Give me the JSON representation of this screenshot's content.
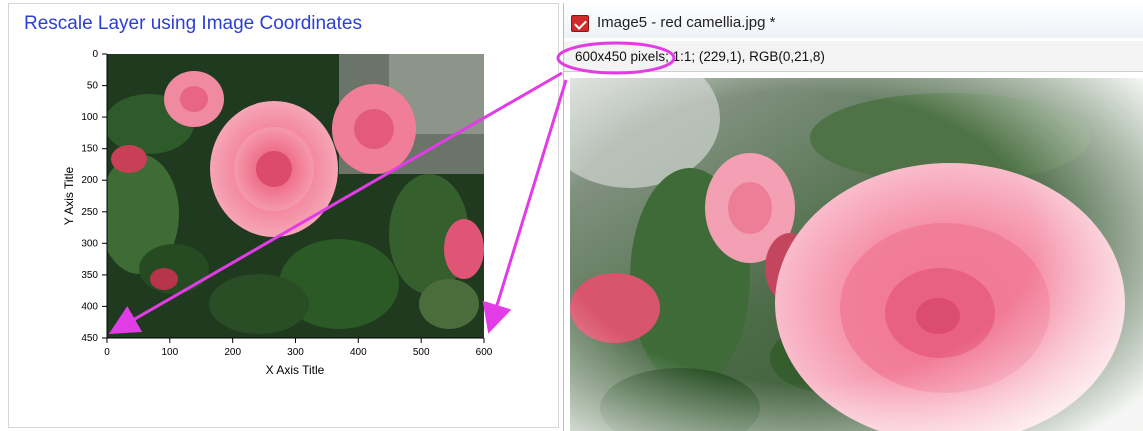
{
  "left_panel": {
    "title": "Rescale Layer using Image Coordinates",
    "graph": {
      "x_axis_title": "X Axis Title",
      "y_axis_title": "Y Axis Title",
      "x_ticks": [
        "0",
        "100",
        "200",
        "300",
        "400",
        "500",
        "600"
      ],
      "y_ticks": [
        "0",
        "50",
        "100",
        "150",
        "200",
        "250",
        "300",
        "350",
        "400",
        "450"
      ]
    }
  },
  "image_window": {
    "title": "Image5 - red camellia.jpg *",
    "status_text": "600x450 pixels; 1:1; (229,1), RGB(0,21,8)",
    "icon": "image-window-icon"
  },
  "annotations": {
    "highlight_color": "#e23ce6",
    "highlighted_text": "600x450 pixels"
  }
}
